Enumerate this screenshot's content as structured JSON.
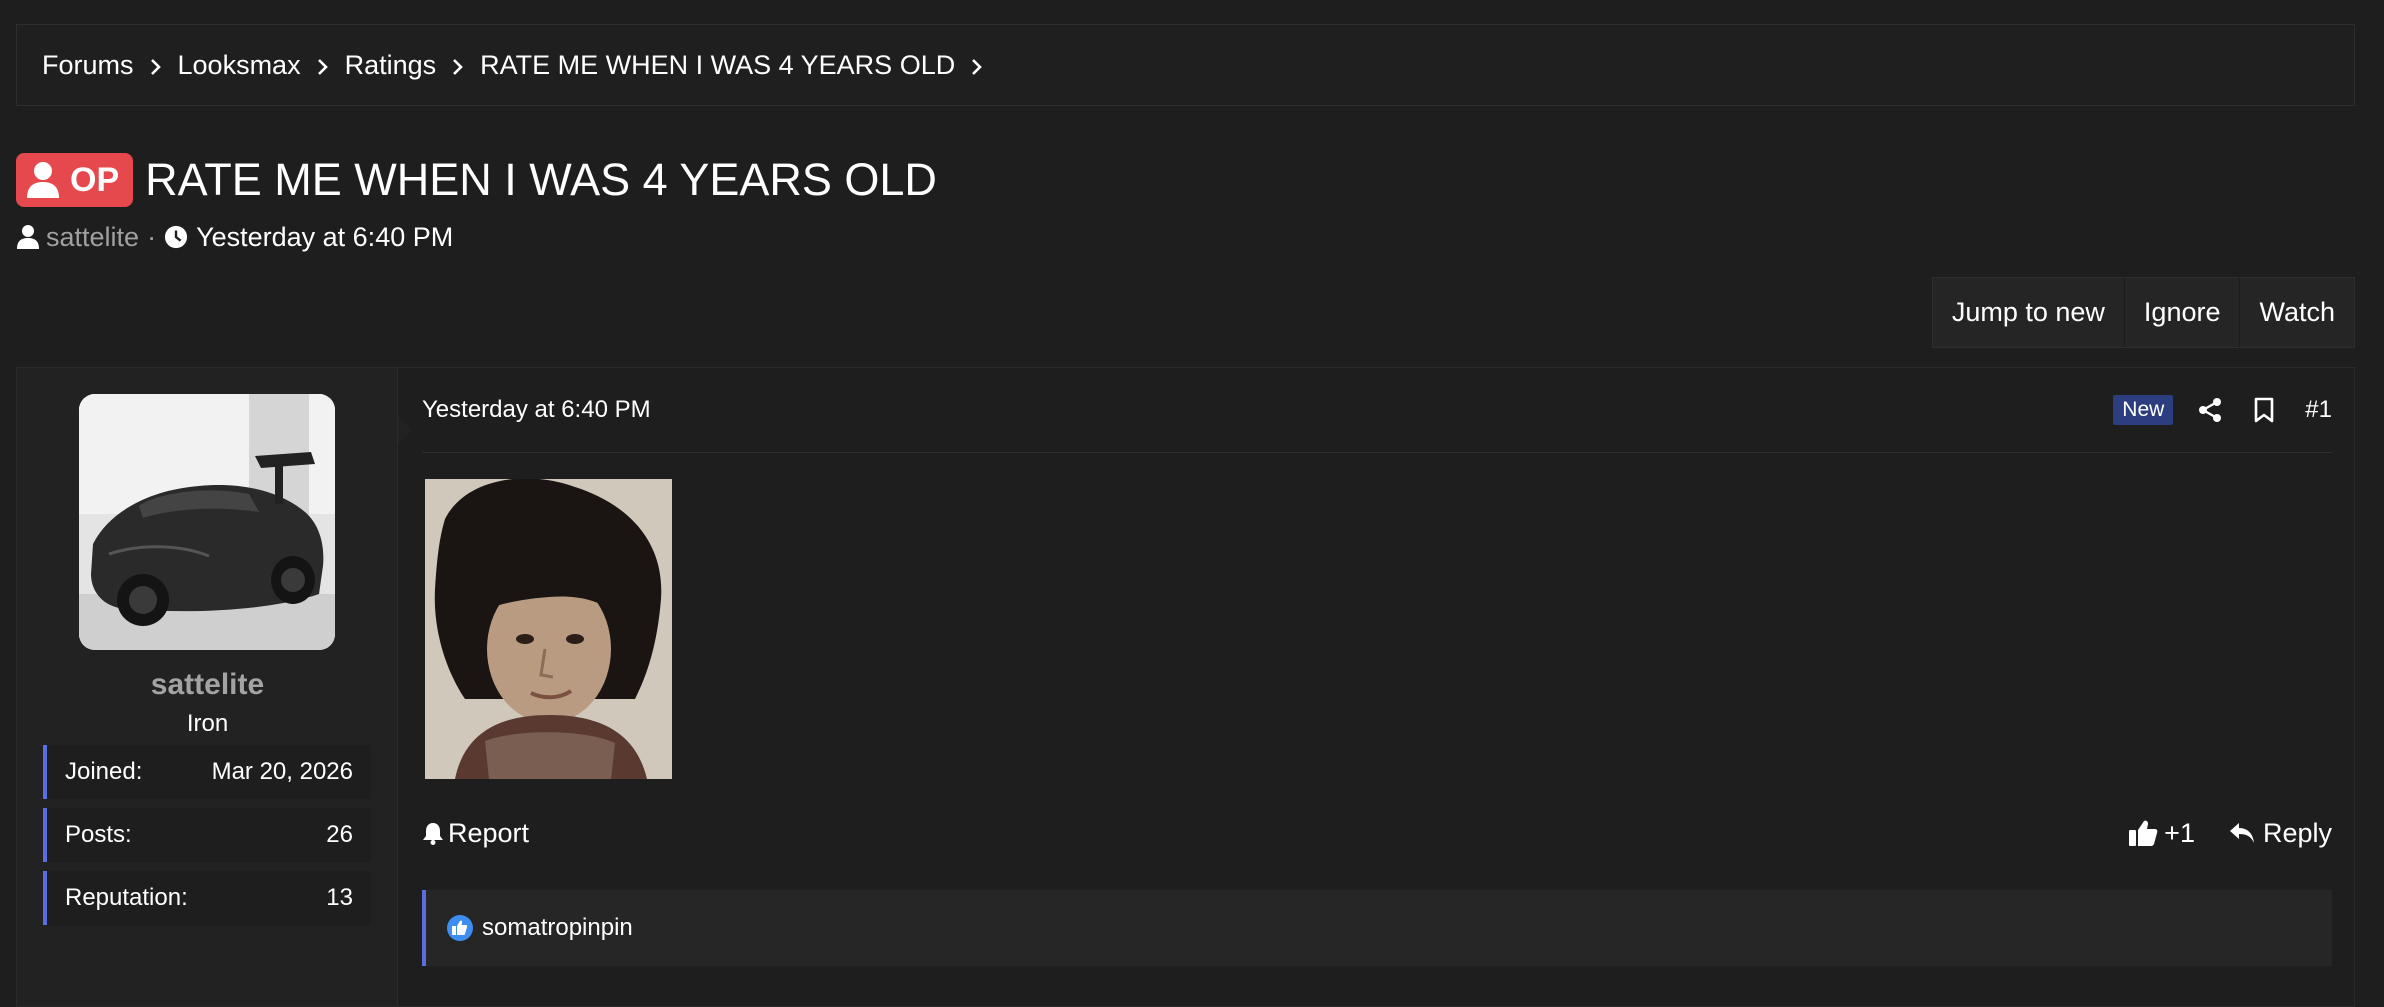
{
  "breadcrumb": {
    "items": [
      {
        "label": "Forums"
      },
      {
        "label": "Looksmax"
      },
      {
        "label": "Ratings"
      },
      {
        "label": "RATE ME WHEN I WAS 4 YEARS OLD"
      }
    ]
  },
  "thread": {
    "prefix_label": "OP",
    "title": "RATE ME WHEN I WAS 4 YEARS OLD",
    "author": "sattelite",
    "separator": "·",
    "started": "Yesterday at 6:40 PM"
  },
  "thread_actions": {
    "jump_label": "Jump to new",
    "ignore_label": "Ignore",
    "watch_label": "Watch"
  },
  "post": {
    "user": {
      "name": "sattelite",
      "title": "Iron",
      "stats": [
        {
          "label": "Joined:",
          "value": "Mar 20, 2026"
        },
        {
          "label": "Posts:",
          "value": "26"
        },
        {
          "label": "Reputation:",
          "value": "13"
        }
      ]
    },
    "date": "Yesterday at 6:40 PM",
    "new_badge": "New",
    "number": "#1",
    "report_label": "Report",
    "like_label": "+1",
    "reply_label": "Reply",
    "reactions": {
      "user": "somatropinpin"
    }
  },
  "icons": {
    "breadcrumb_separator": "chevron-right-icon",
    "author": "user-icon",
    "time": "clock-icon",
    "share": "share-icon",
    "bookmark": "bookmark-icon",
    "report": "bell-icon",
    "like": "thumbs-up-icon",
    "reply": "reply-icon"
  },
  "colors": {
    "background": "#1e1e1e",
    "op_badge": "#e5484d",
    "accent_border": "#5b6ee1",
    "new_badge": "#2c3e80",
    "muted_text": "#a0a0a0"
  }
}
